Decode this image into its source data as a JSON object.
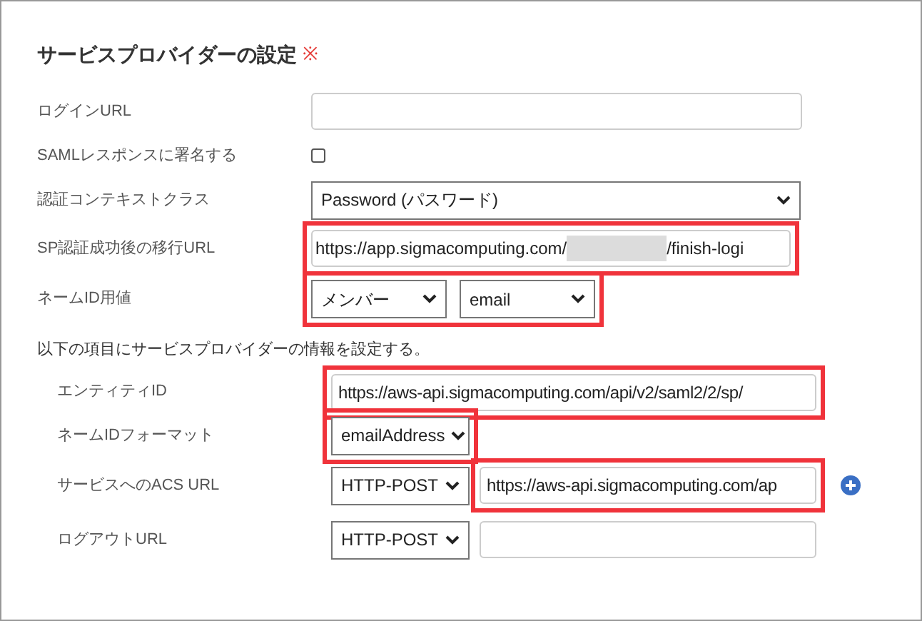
{
  "section": {
    "title": "サービスプロバイダーの設定",
    "required_mark": "※"
  },
  "rows": [
    {
      "kind": "text",
      "label": "ログインURL",
      "highlighted": false
    },
    {
      "kind": "checkbox",
      "label": "SAMLレスポンスに署名する",
      "checked": false
    },
    {
      "kind": "select",
      "label": "認証コンテキストクラス",
      "value": "Password (パスワード)",
      "highlighted": false
    },
    {
      "kind": "redacted_text",
      "label": "SP認証成功後の移行URL",
      "value_parts": [
        "https://app.sigmacomputing.com/",
        "/finish-logi"
      ],
      "highlighted": true
    },
    {
      "kind": "select_pair",
      "label": "ネームID用値",
      "values": [
        "メンバー",
        "email"
      ],
      "highlighted": true
    }
  ],
  "info": "以下の項目にサービスプロバイダーの情報を設定する。",
  "sub_rows": [
    {
      "kind": "text",
      "label": "エンティティID",
      "value": "https://aws-api.sigmacomputing.com/api/v2/saml2/2/sp/",
      "highlighted": true
    },
    {
      "kind": "short_select",
      "label": "ネームIDフォーマット",
      "value": "emailAddress",
      "highlighted": true
    },
    {
      "kind": "select_text",
      "label": "サービスへのACS URL",
      "method": "HTTP-POST",
      "value": "https://aws-api.sigmacomputing.com/ap",
      "highlighted": true,
      "add_button": true
    },
    {
      "kind": "select_text",
      "label": "ログアウトURL",
      "method": "HTTP-POST",
      "highlighted": false,
      "add_button": false
    }
  ]
}
